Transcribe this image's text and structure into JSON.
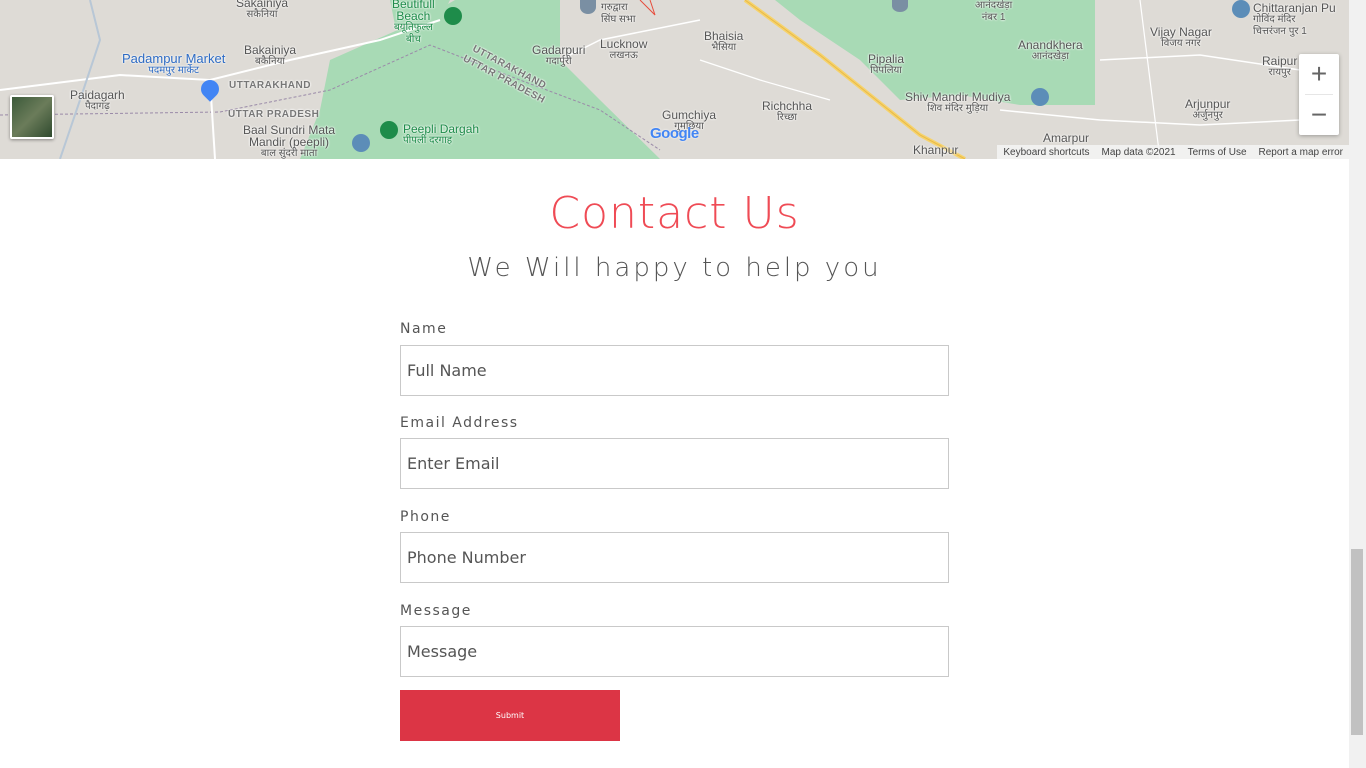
{
  "map": {
    "labels": {
      "sakainiya": "Sakainiya",
      "sakainiya_hi": "सकैनिया",
      "beautifull": "Beutifull",
      "beach": "Beach",
      "beach_hi": "बयूतिफुल्ल",
      "beach_hi2": "बीच",
      "padampur": "Padampur Market",
      "padampur_hi": "पदमपुर मार्केट",
      "bakainiya": "Bakainiya",
      "bakainiya_hi": "बकैनिया",
      "paidagarh": "Paidagarh",
      "paidagarh_hi": "पैदागढ़",
      "uttarakhand1": "UTTARAKHAND",
      "uttarpradesh1": "UTTAR PRADESH",
      "uttarakhand2": "UTTARAKHAND",
      "uttarpradesh2": "UTTAR PRADESH",
      "baal": "Baal Sundri Mata",
      "baal2": "Mandir (peepli)",
      "baal_hi": "बाल सुंदरी माता",
      "peepli": "Peepli Dargah",
      "peepli_hi": "पीपली दरगाह",
      "gadarpuri": "Gadarpuri",
      "gadarpuri_hi": "गदार्पुरी",
      "lucknow": "Lucknow",
      "lucknow_hi": "लखनऊ",
      "gurudwara_hi": "गरुद्वारा",
      "singh_hi": "सिंघ सभा",
      "bhaisia": "Bhaisia",
      "bhaisia_hi": "भैसिया",
      "gumchiya": "Gumchiya",
      "gumchiya_hi": "गुमछिया",
      "richchha": "Richchha",
      "richchha_hi": "रिच्छा",
      "pipalia": "Pipalia",
      "pipalia_hi": "पिपलिया",
      "anandkhera_top": "आनंदखेड़ा",
      "number1": "नंबर 1",
      "anandkhera": "Anandkhera",
      "anandkhera_hi": "आनंदखेड़ा",
      "shiv": "Shiv Mandir Mudiya",
      "shiv_hi": "शिव मंदिर मुड़िया",
      "khanpur": "Khanpur",
      "amarpur": "Amarpur",
      "vijay": "Vijay Nagar",
      "vijay_hi": "विजय नगर",
      "arjunpur": "Arjunpur",
      "arjunpur_hi": "अर्जुनपुर",
      "chittaranjan": "Chittaranjan Pu",
      "chittaranjan_hi": "गोविंद मंदिर",
      "chittaranjan_hi2": "चित्तरंजन पुर 1",
      "raipur": "Raipur",
      "raipur_hi": "रायपुर"
    },
    "google_logo": "Google",
    "zoom_in": "+",
    "zoom_out": "−",
    "attribution": {
      "shortcuts": "Keyboard shortcuts",
      "data": "Map data ©2021",
      "terms": "Terms of Use",
      "report": "Report a map error"
    }
  },
  "contact": {
    "title": "Contact Us",
    "subtitle": "We Will happy to help you",
    "fields": {
      "name": {
        "label": "Name",
        "placeholder": "Full Name"
      },
      "email": {
        "label": "Email Address",
        "placeholder": "Enter Email"
      },
      "phone": {
        "label": "Phone",
        "placeholder": "Phone Number"
      },
      "message": {
        "label": "Message",
        "placeholder": "Message"
      }
    },
    "submit_label": "Submit"
  },
  "colors": {
    "accent": "#ef4b55",
    "submit_bg": "#dc3545",
    "map_bg": "#dedbd6",
    "park_green": "#a8dab5",
    "highway_yellow": "#f6d36b"
  }
}
